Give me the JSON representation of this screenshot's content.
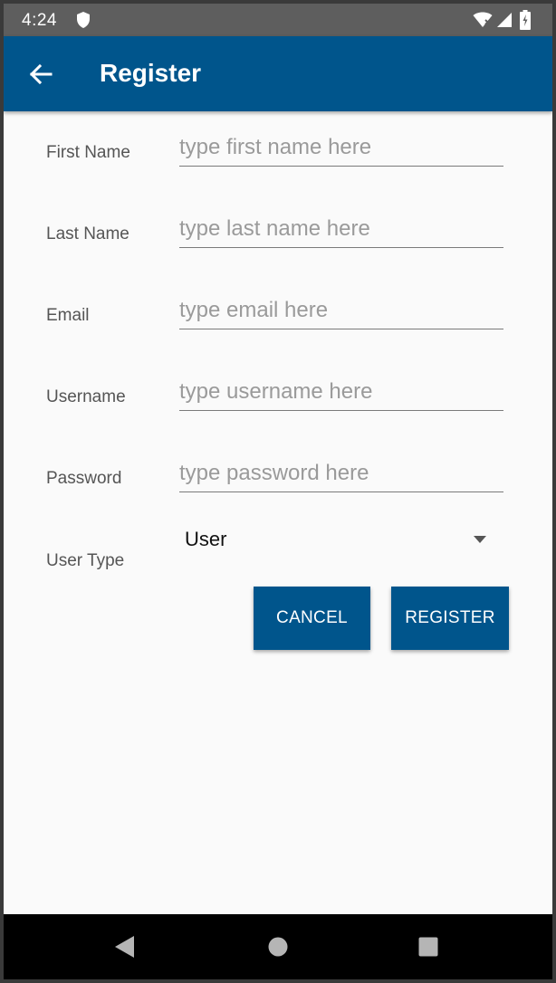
{
  "status_bar": {
    "time": "4:24",
    "icons": [
      "shield-icon",
      "wifi-icon",
      "signal-icon",
      "battery-icon"
    ]
  },
  "app_bar": {
    "title": "Register",
    "back_icon": "arrow-left-icon",
    "color": "#00558c"
  },
  "form": {
    "first_name": {
      "label": "First Name",
      "placeholder": "type first name here",
      "value": ""
    },
    "last_name": {
      "label": "Last Name",
      "placeholder": "type last name here",
      "value": ""
    },
    "email": {
      "label": "Email",
      "placeholder": "type email here",
      "value": ""
    },
    "username": {
      "label": "Username",
      "placeholder": "type username here",
      "value": ""
    },
    "password": {
      "label": "Password",
      "placeholder": "type password here",
      "value": ""
    },
    "user_type": {
      "label": "User Type",
      "selected": "User"
    }
  },
  "buttons": {
    "cancel": "CANCEL",
    "register": "REGISTER"
  },
  "nav_bar": {
    "icons": [
      "back-triangle-icon",
      "home-circle-icon",
      "recents-square-icon"
    ]
  }
}
